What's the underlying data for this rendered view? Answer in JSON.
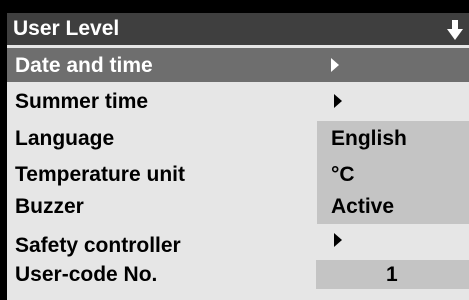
{
  "menu": {
    "title": "User Level",
    "items": [
      {
        "label": "Date and time",
        "value": ""
      },
      {
        "label": "Summer time",
        "value": ""
      },
      {
        "label": "Language",
        "value": "English"
      },
      {
        "label": "Temperature unit",
        "value": "°C"
      },
      {
        "label": "Buzzer",
        "value": "Active"
      },
      {
        "label": "Safety controller",
        "value": ""
      },
      {
        "label": "User-code No.",
        "value": "1"
      }
    ]
  },
  "icons": {
    "header": "scroll-down-arrow-icon",
    "submenu": "chevron-right-icon"
  },
  "colors": {
    "header_background": "#3f3f3f",
    "selected_row_background": "#6e6e6e",
    "panel_background": "#e6e6e6",
    "value_field_background": "#c4c4c4"
  }
}
